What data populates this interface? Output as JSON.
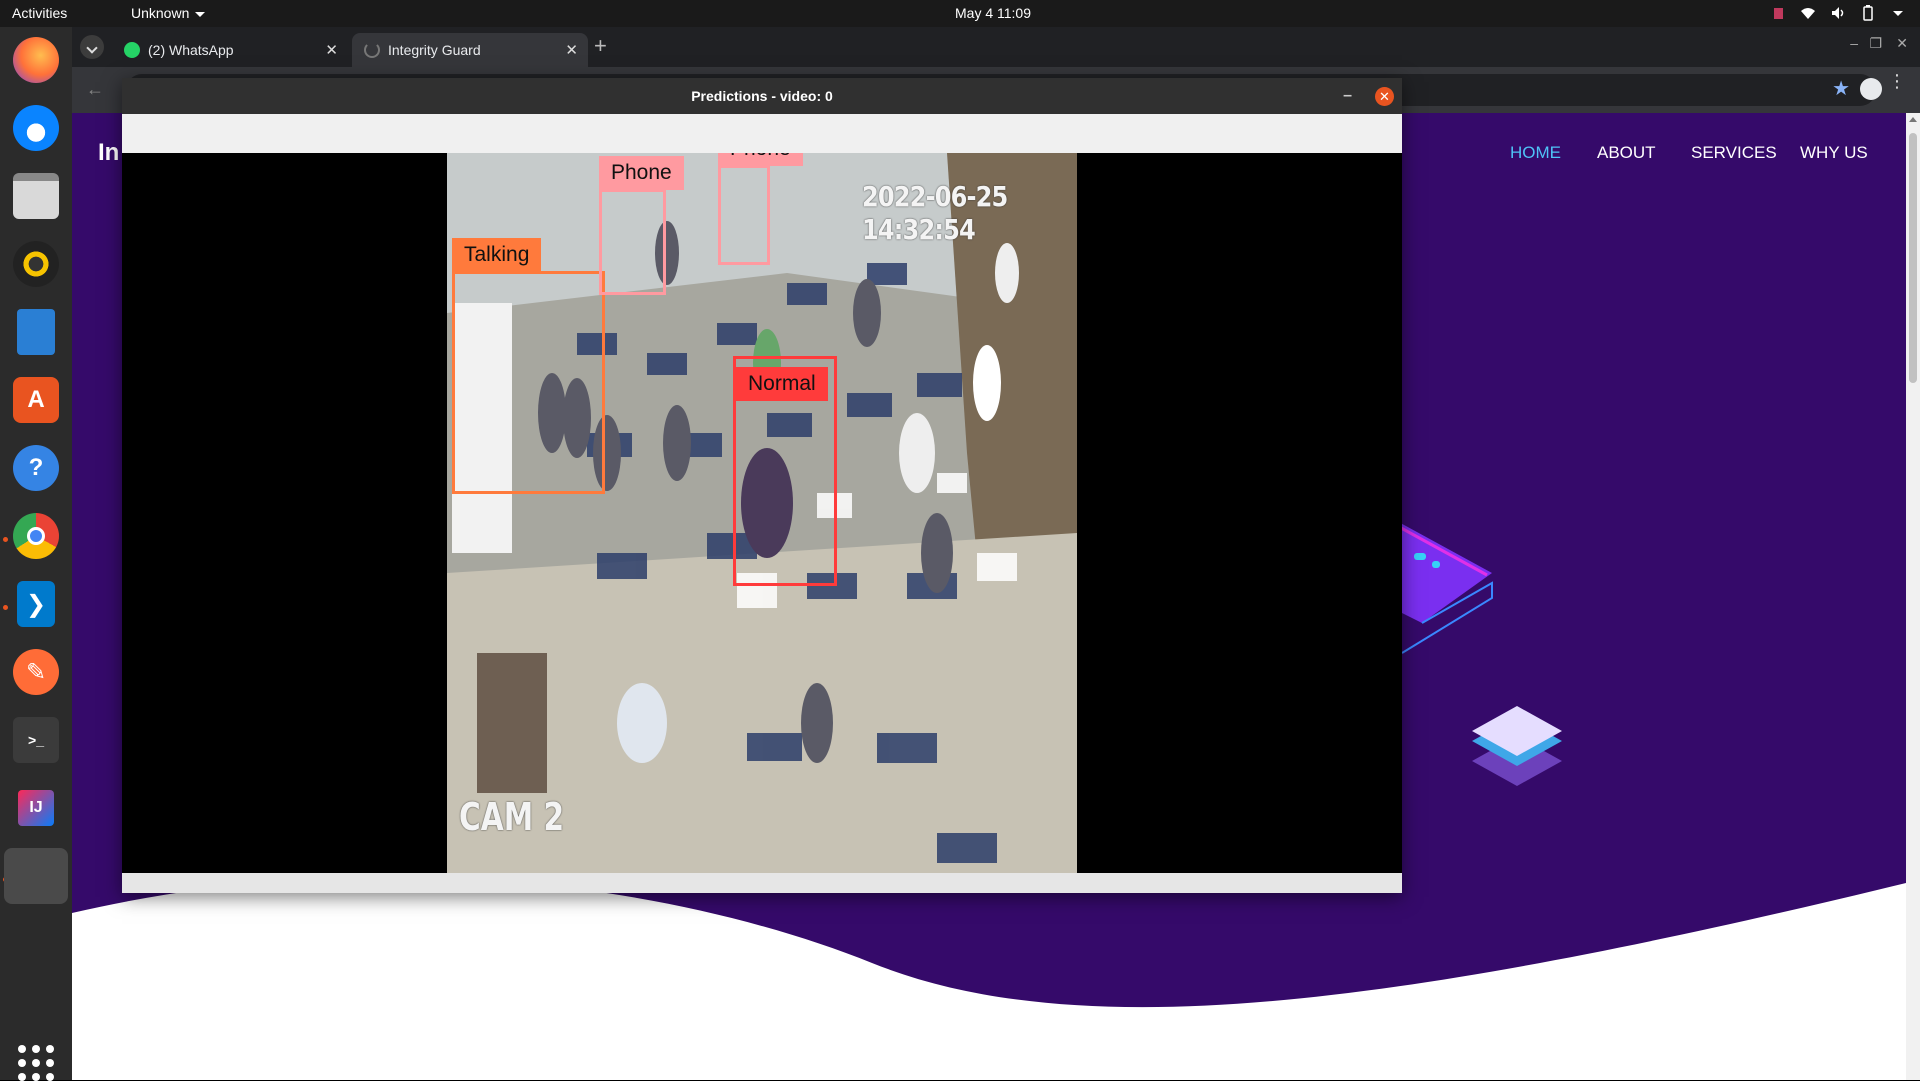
{
  "topbar": {
    "activities": "Activities",
    "app_menu": "Unknown",
    "clock": "May 4  11:09"
  },
  "dock": {
    "apps": [
      {
        "name": "Firefox",
        "icon": "firefox-icon",
        "color": "#ff7139"
      },
      {
        "name": "Thunderbird",
        "icon": "thunderbird-icon",
        "color": "#0a84ff"
      },
      {
        "name": "Files",
        "icon": "files-icon",
        "color": "#b7b7b7"
      },
      {
        "name": "Rhythmbox",
        "icon": "rhythmbox-icon",
        "color": "#f7c400"
      },
      {
        "name": "LibreOffice Writer",
        "icon": "writer-icon",
        "color": "#2a7fd4"
      },
      {
        "name": "Ubuntu Software",
        "icon": "software-icon",
        "color": "#e95420"
      },
      {
        "name": "Help",
        "icon": "help-icon",
        "color": "#3584e4"
      },
      {
        "name": "Google Chrome",
        "icon": "chrome-icon",
        "color": "#4285f4"
      },
      {
        "name": "Visual Studio Code",
        "icon": "vscode-icon",
        "color": "#007acc"
      },
      {
        "name": "Postman",
        "icon": "postman-icon",
        "color": "#ff6c37"
      },
      {
        "name": "Terminal",
        "icon": "terminal-icon",
        "color": "#3b3b3b"
      },
      {
        "name": "IntelliJ IDEA",
        "icon": "intellij-icon",
        "color": "#fe2857"
      },
      {
        "name": "Running window",
        "icon": "window-icon",
        "color": "#555555"
      }
    ]
  },
  "browser": {
    "tabs": [
      {
        "label": "(2) WhatsApp",
        "icon": "whatsapp-icon",
        "active": false
      },
      {
        "label": "Integrity Guard",
        "icon": "loading-icon",
        "active": true
      }
    ]
  },
  "website": {
    "brand": "In",
    "nav": [
      "HOME",
      "ABOUT",
      "SERVICES",
      "WHY US"
    ],
    "accent": "#4fc3f7",
    "background": "#350a6a"
  },
  "cv_window": {
    "title": "Predictions - video: 0",
    "timestamp": "2022-06-25 14:32:54",
    "camera": "CAM 2",
    "detections": [
      {
        "label": "Talking",
        "color": "#ff7a3c"
      },
      {
        "label": "Phone",
        "color": "#ff9aa0"
      },
      {
        "label": "Phone",
        "color": "#ff9aa0"
      },
      {
        "label": "Normal",
        "color": "#ff3b3b"
      }
    ]
  }
}
